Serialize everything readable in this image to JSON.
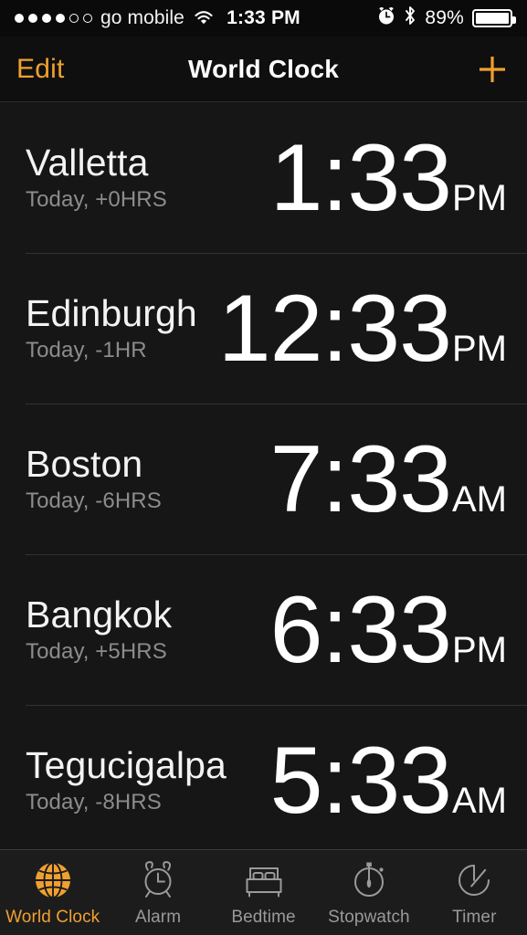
{
  "colors": {
    "accent": "#f0a030",
    "background": "#161616",
    "navbar_bg": "#0f0f0f",
    "tabbar_bg": "#1c1c1c",
    "divider": "#323232",
    "primary_text": "#ffffff",
    "secondary_text": "#8c8c8c"
  },
  "status_bar": {
    "signal_dots_filled": 4,
    "signal_dots_total": 6,
    "carrier": "go mobile",
    "wifi_icon": "wifi-icon",
    "time": "1:33 PM",
    "alarm_icon": "alarm-clock-icon",
    "bluetooth_icon": "bluetooth-icon",
    "battery_percent": "89%",
    "battery_level": 89
  },
  "nav_bar": {
    "edit_label": "Edit",
    "title": "World Clock",
    "add_icon": "plus-icon"
  },
  "clocks": [
    {
      "city": "Valletta",
      "offset": "Today, +0HRS",
      "time": "1:33",
      "suffix": "PM"
    },
    {
      "city": "Edinburgh",
      "offset": "Today, -1HR",
      "time": "12:33",
      "suffix": "PM"
    },
    {
      "city": "Boston",
      "offset": "Today, -6HRS",
      "time": "7:33",
      "suffix": "AM"
    },
    {
      "city": "Bangkok",
      "offset": "Today, +5HRS",
      "time": "6:33",
      "suffix": "PM"
    },
    {
      "city": "Tegucigalpa",
      "offset": "Today, -8HRS",
      "time": "5:33",
      "suffix": "AM"
    }
  ],
  "tab_bar": {
    "tabs": [
      {
        "label": "World Clock",
        "icon": "globe-icon",
        "selected": true
      },
      {
        "label": "Alarm",
        "icon": "alarm-clock-icon",
        "selected": false
      },
      {
        "label": "Bedtime",
        "icon": "bed-icon",
        "selected": false
      },
      {
        "label": "Stopwatch",
        "icon": "stopwatch-icon",
        "selected": false
      },
      {
        "label": "Timer",
        "icon": "timer-icon",
        "selected": false
      }
    ]
  }
}
